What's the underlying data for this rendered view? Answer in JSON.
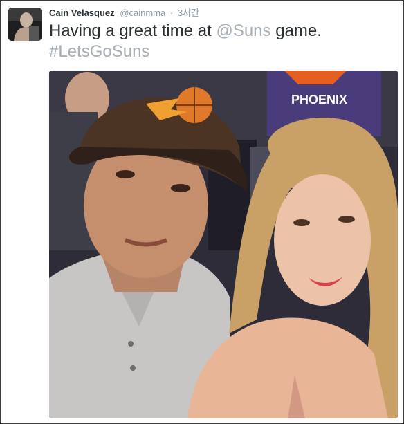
{
  "tweet": {
    "author_name": "Cain Velasquez",
    "handle": "@cainmma",
    "separator": "·",
    "time": "3시간",
    "text_before": "Having a great time at ",
    "mention": "@Suns",
    "text_after": " game.",
    "hashtag": "#LetsGoSuns"
  },
  "photo": {
    "jersey_text": "PHOENIX",
    "subject": "selfie-courtside"
  },
  "colors": {
    "text": "#292f33",
    "muted": "#8899a6",
    "link": "#a6aeb6",
    "suns_orange": "#e56020"
  }
}
